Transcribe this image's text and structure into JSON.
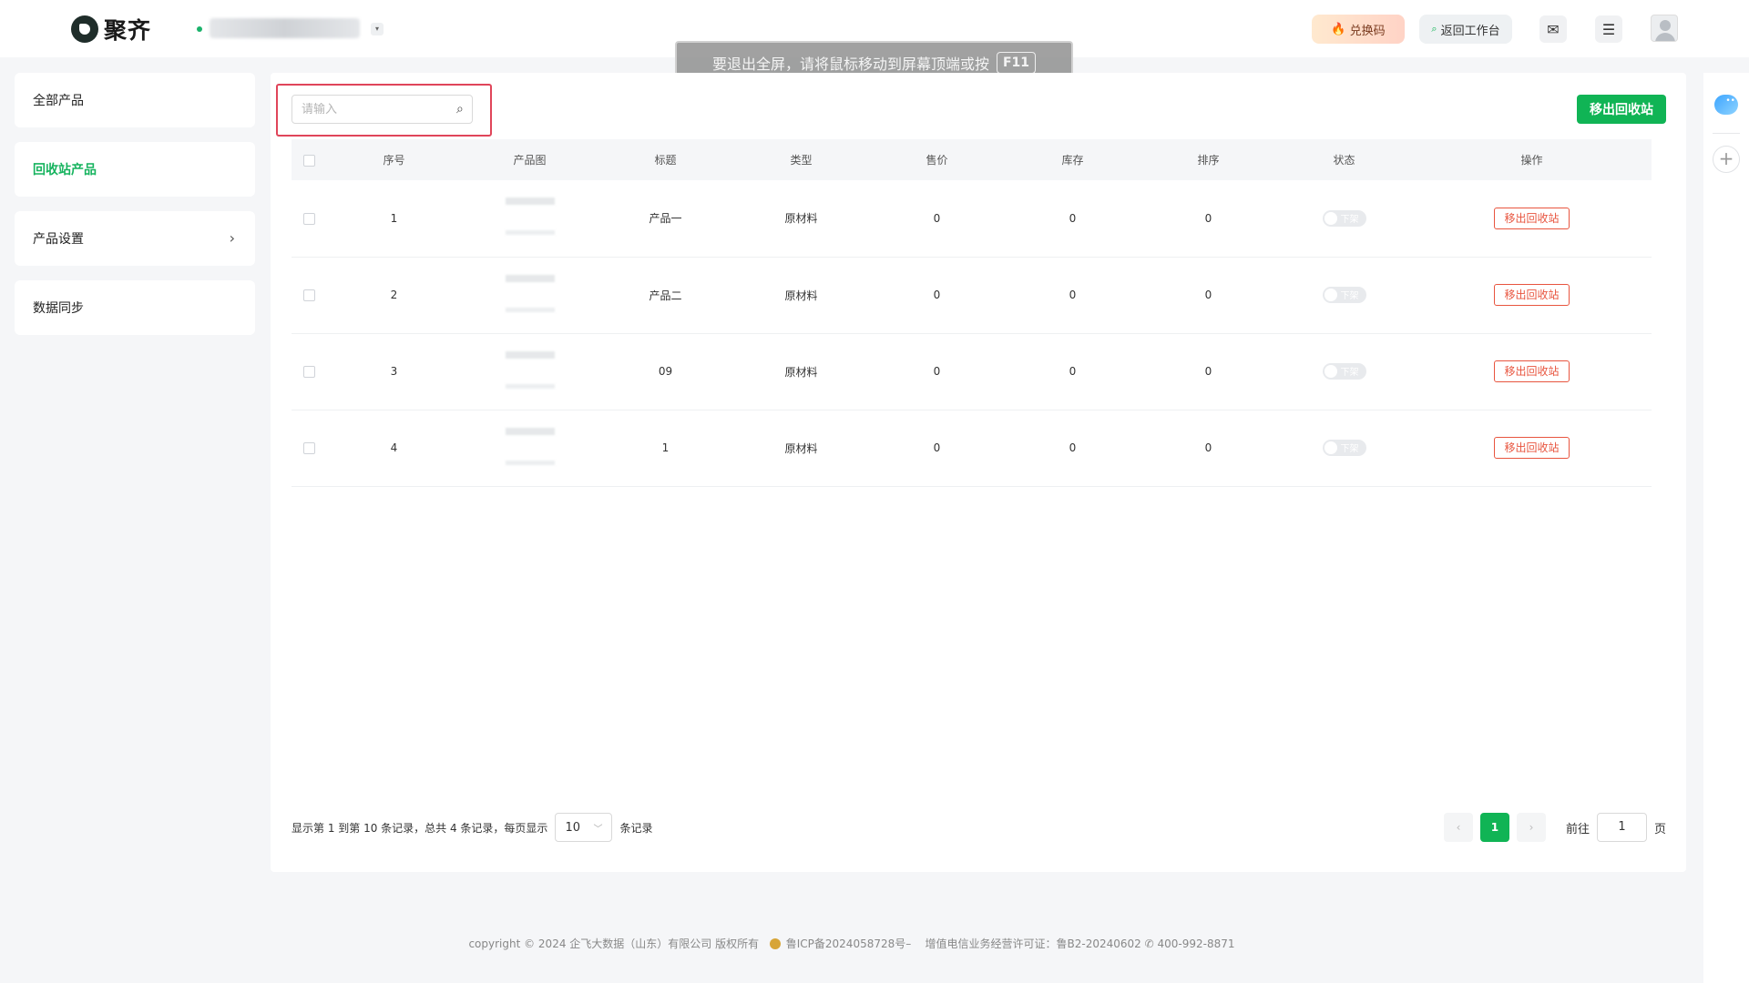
{
  "header": {
    "logo_text": "聚齐",
    "redeem_label": "兑换码",
    "workbench_label": "返回工作台"
  },
  "toast": {
    "message": "要退出全屏，请将鼠标移动到屏幕顶端或按",
    "key": "F11"
  },
  "sidebar": {
    "items": [
      {
        "label": "全部产品"
      },
      {
        "label": "回收站产品"
      },
      {
        "label": "产品设置"
      },
      {
        "label": "数据同步"
      }
    ]
  },
  "toolbar": {
    "search_placeholder": "请输入",
    "restore_button": "移出回收站"
  },
  "table": {
    "columns": [
      "序号",
      "产品图",
      "标题",
      "类型",
      "售价",
      "库存",
      "排序",
      "状态",
      "操作"
    ],
    "rows": [
      {
        "index": "1",
        "title": "产品一",
        "type": "原材料",
        "price": "0",
        "stock": "0",
        "sort": "0",
        "status": "下架",
        "action": "移出回收站"
      },
      {
        "index": "2",
        "title": "产品二",
        "type": "原材料",
        "price": "0",
        "stock": "0",
        "sort": "0",
        "status": "下架",
        "action": "移出回收站"
      },
      {
        "index": "3",
        "title": "09",
        "type": "原材料",
        "price": "0",
        "stock": "0",
        "sort": "0",
        "status": "下架",
        "action": "移出回收站"
      },
      {
        "index": "4",
        "title": "1",
        "type": "原材料",
        "price": "0",
        "stock": "0",
        "sort": "0",
        "status": "下架",
        "action": "移出回收站"
      }
    ]
  },
  "pagination": {
    "info": "显示第 1 到第 10 条记录，总共 4 条记录，每页显示",
    "page_size": "10",
    "suffix": "条记录",
    "prev": "‹",
    "current_page": "1",
    "next": "›",
    "goto_label": "前往",
    "goto_value": "1",
    "page_unit": "页"
  },
  "footer": {
    "copyright": "copyright © 2024 企飞大数据（山东）有限公司 版权所有",
    "icp": "鲁ICP备2024058728号–",
    "license": "增值电信业务经营许可证：鲁B2-20240602",
    "phone": "400-992-8871"
  },
  "colors": {
    "brand_green": "#10b455",
    "danger": "#e8553f"
  }
}
